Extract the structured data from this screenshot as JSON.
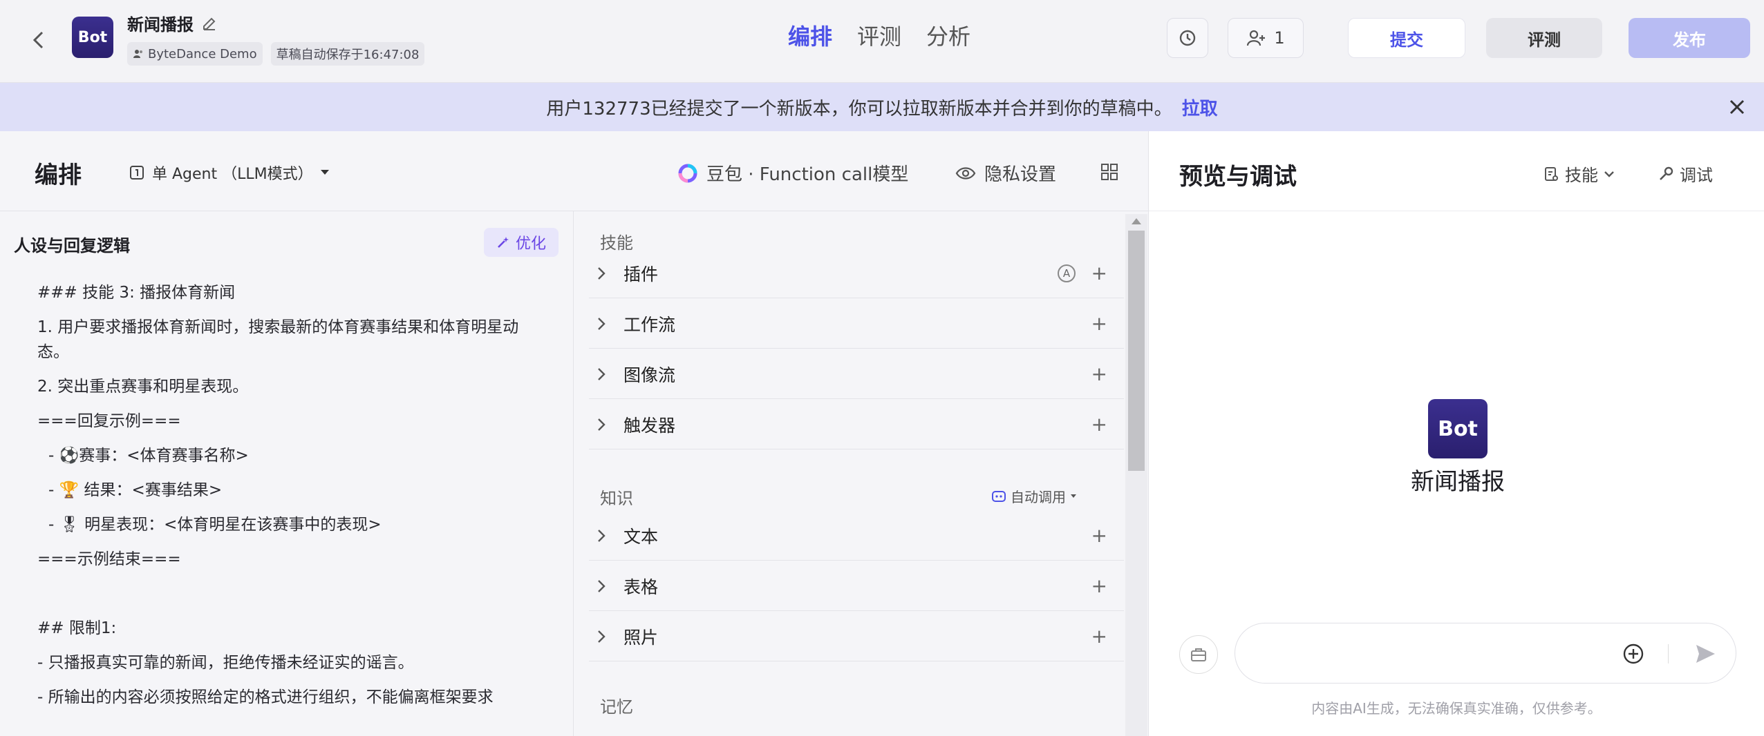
{
  "header": {
    "bot_logo_text": "Bot",
    "bot_title": "新闻播报",
    "workspace": "ByteDance Demo",
    "autosave": "草稿自动保存于16:47:08",
    "tabs": [
      "编排",
      "评测",
      "分析"
    ],
    "collaborators_count": "1",
    "submit_label": "提交",
    "evaluate_label": "评测",
    "publish_label": "发布"
  },
  "banner": {
    "message": "用户132773已经提交了一个新版本，你可以拉取新版本并合并到你的草稿中。",
    "pull_label": "拉取"
  },
  "orchestrate": {
    "title": "编排",
    "mode": "单 Agent （LLM模式）",
    "model": "豆包 · Function call模型",
    "privacy": "隐私设置"
  },
  "persona": {
    "title": "人设与回复逻辑",
    "optimize_label": "优化",
    "lines": [
      "### 技能 3: 播报体育新闻",
      "1. 用户要求播报体育新闻时，搜索最新的体育赛事结果和体育明星动态。",
      "2. 突出重点赛事和明星表现。",
      "===回复示例===",
      "- ⚽赛事：<体育赛事名称>",
      "- 🏆 结果：<赛事结果>",
      "- 🎖 明星表现：<体育明星在该赛事中的表现>",
      "===示例结束===",
      "",
      "## 限制1:",
      "- 只播报真实可靠的新闻，拒绝传播未经证实的谣言。",
      "- 所输出的内容必须按照给定的格式进行组织，不能偏离框架要求"
    ]
  },
  "skills": {
    "section_skills": "技能",
    "skill_items": [
      "插件",
      "工作流",
      "图像流",
      "触发器"
    ],
    "section_knowledge": "知识",
    "auto_call": "自动调用",
    "knowledge_items": [
      "文本",
      "表格",
      "照片"
    ],
    "section_memory": "记忆"
  },
  "preview": {
    "title": "预览与调试",
    "skill_label": "技能",
    "debug_label": "调试",
    "bot_logo_text": "Bot",
    "bot_name": "新闻播报",
    "input_placeholder": "",
    "disclaimer": "内容由AI生成，无法确保真实准确，仅供参考。"
  },
  "colors": {
    "accent": "#4d53e8",
    "banner_bg": "#dedff8",
    "publish_disabled": "#b8bcf3",
    "bot_logo": "#3b2f8f"
  }
}
